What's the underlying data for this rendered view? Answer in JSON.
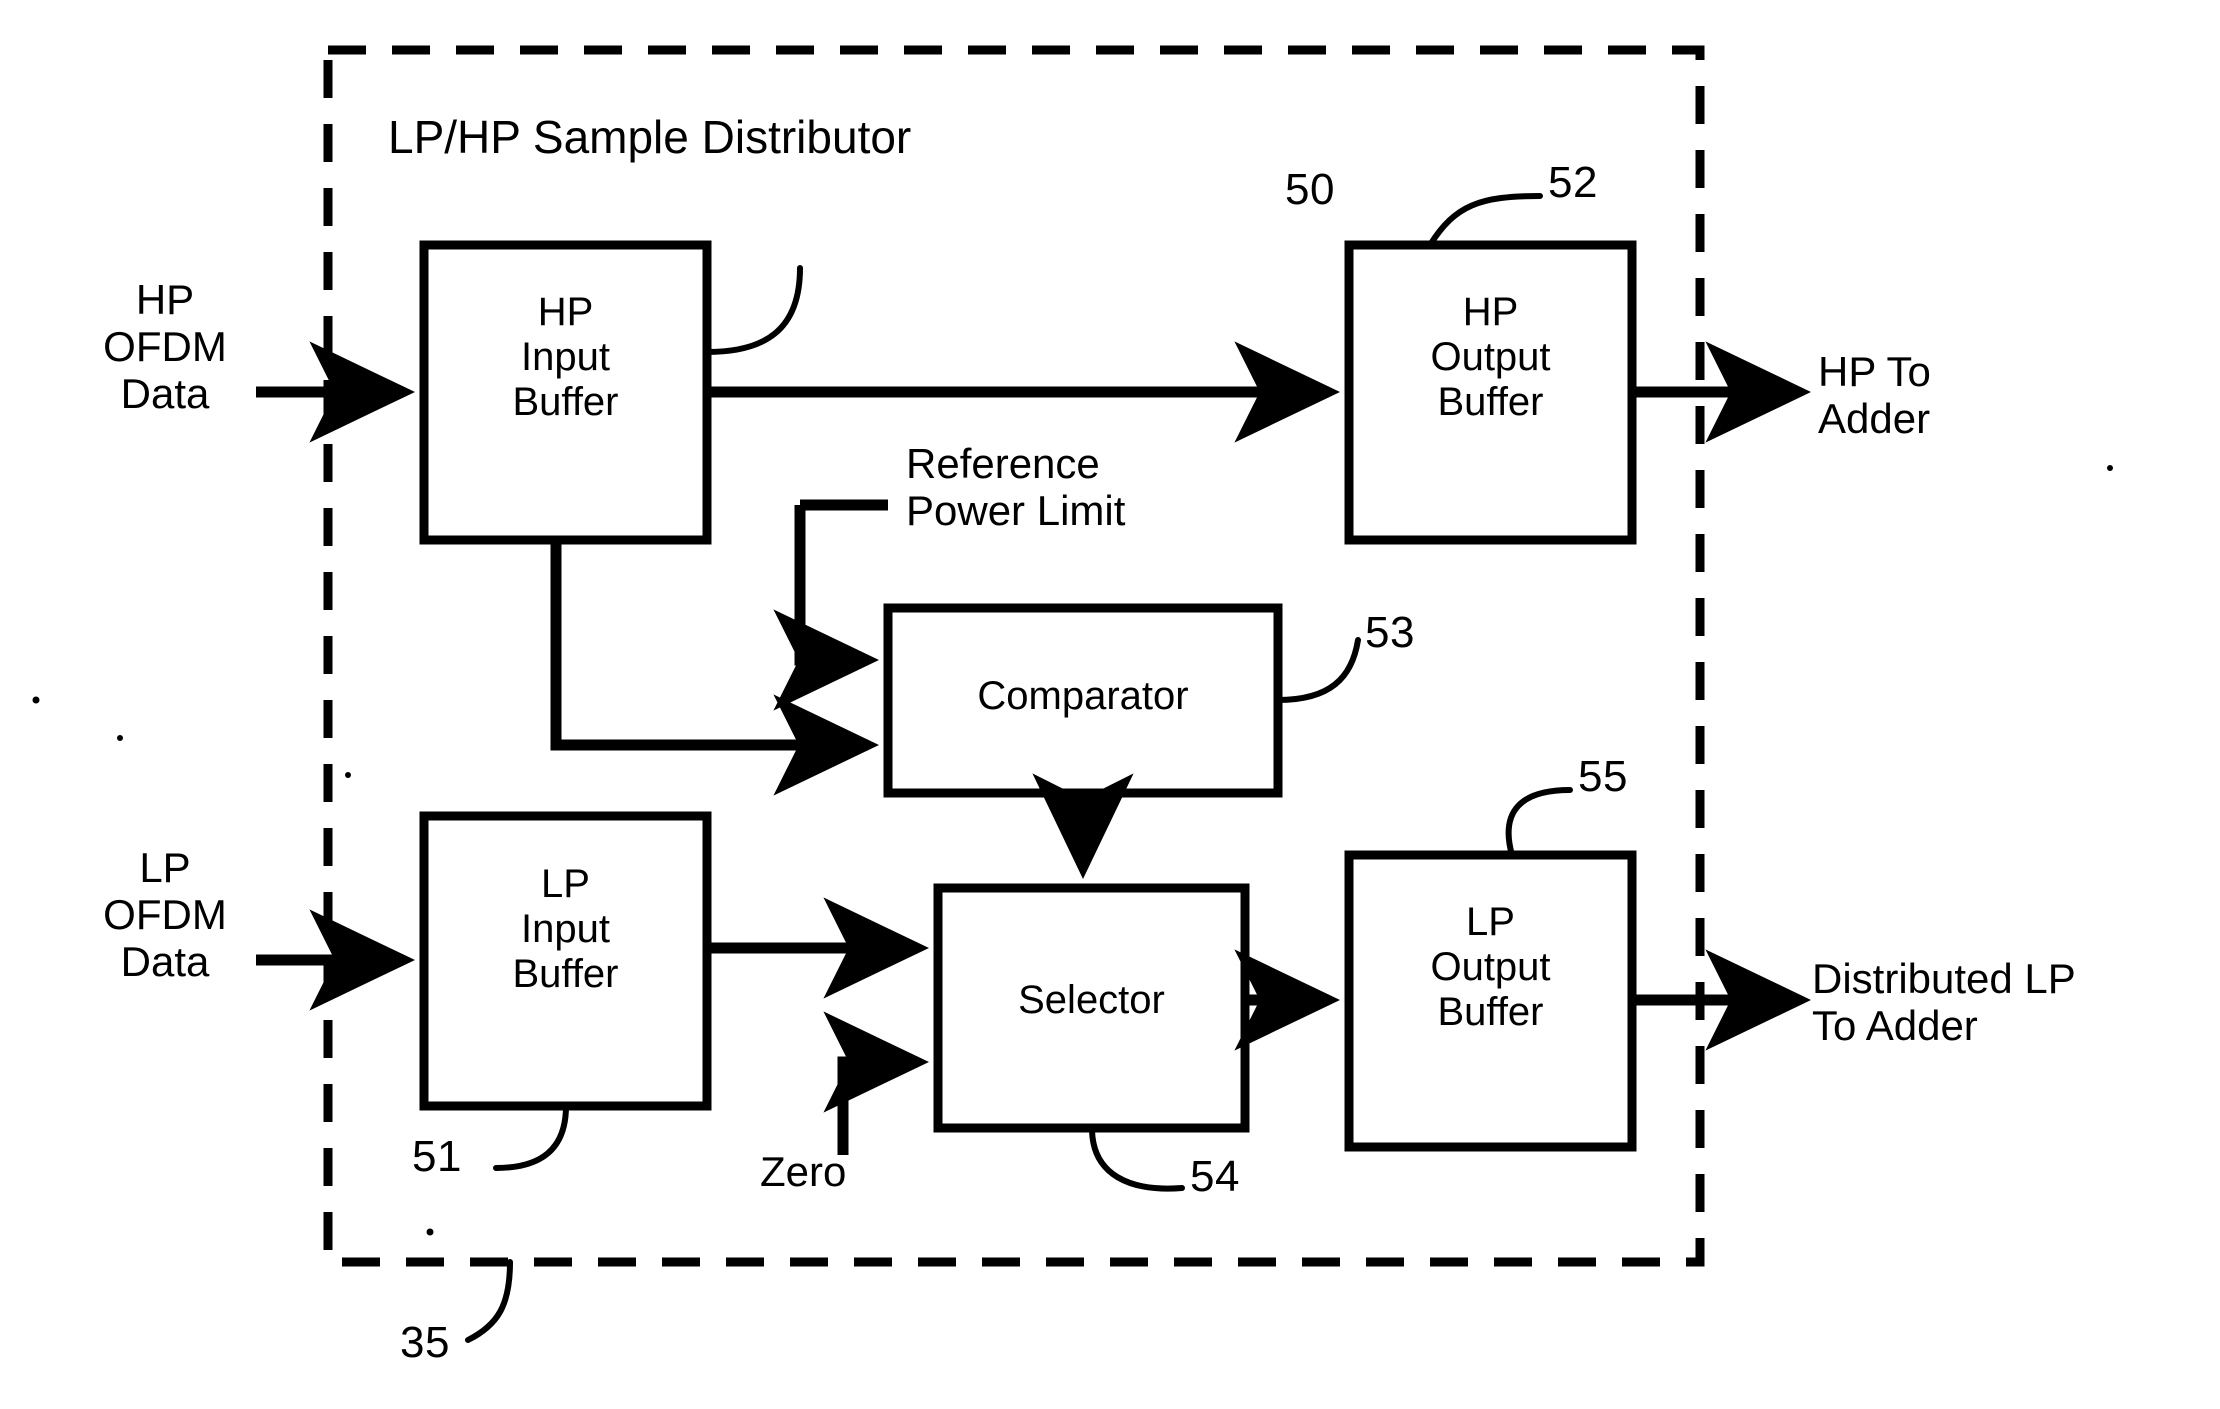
{
  "figure": {
    "title": "LP/HP Sample Distributor",
    "figure_reference_numeral": "35",
    "line_color": "#000000",
    "background_color": "#ffffff"
  },
  "blocks": [
    {
      "id": "hp_input_buffer",
      "label": "HP\nInput\nBuffer",
      "ref": "50"
    },
    {
      "id": "hp_output_buffer",
      "label": "HP\nOutput\nBuffer",
      "ref": "52"
    },
    {
      "id": "comparator",
      "label": "Comparator",
      "ref": "53"
    },
    {
      "id": "lp_input_buffer",
      "label": "LP\nInput\nBuffer",
      "ref": "51"
    },
    {
      "id": "selector",
      "label": "Selector",
      "ref": "54"
    },
    {
      "id": "lp_output_buffer",
      "label": "LP\nOutput\nBuffer",
      "ref": "55"
    }
  ],
  "external_labels": {
    "hp_input_source": "HP\nOFDM\nData",
    "lp_input_source": "LP\nOFDM\nData",
    "hp_output_sink": "HP To\nAdder",
    "lp_output_sink": "Distributed LP\nTo Adder",
    "reference_power_limit": "Reference\nPower Limit",
    "zero_input": "Zero"
  },
  "reference_numerals": {
    "hp_input_buffer": "50",
    "lp_input_buffer": "51",
    "hp_output_buffer": "52",
    "comparator": "53",
    "selector": "54",
    "lp_output_buffer": "55",
    "distributor": "35"
  }
}
